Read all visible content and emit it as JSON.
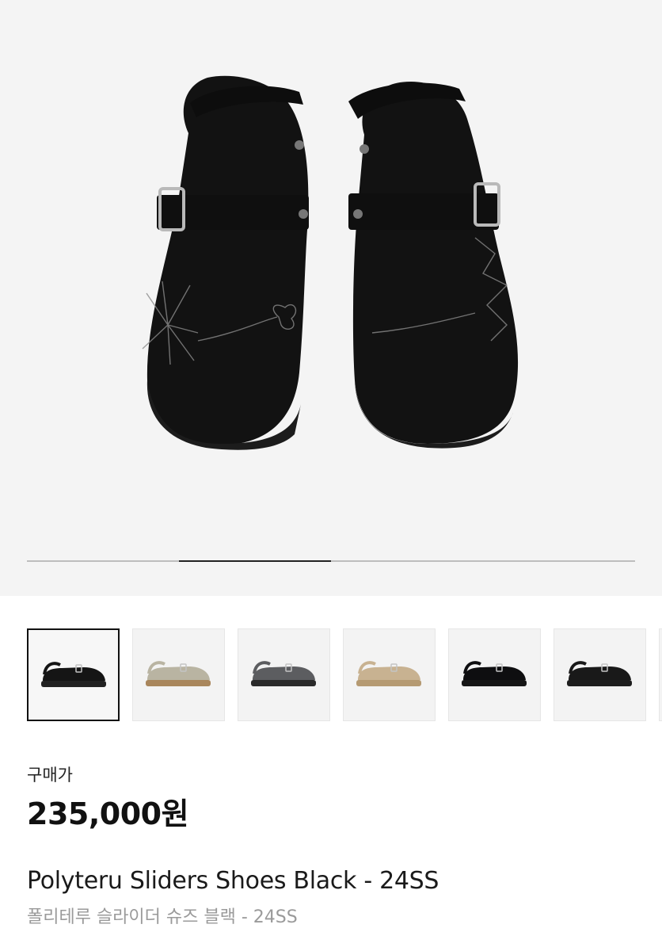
{
  "gallery": {
    "current_slide": 2,
    "total_slides": 4,
    "image_alt": "product-photo-black-suede-sliders"
  },
  "thumbnails": [
    {
      "color_name": "black-suede",
      "upper": "#151515",
      "sole": "#222222",
      "selected": true
    },
    {
      "color_name": "grey-beige",
      "upper": "#b9b4a2",
      "sole": "#a9865c",
      "selected": false
    },
    {
      "color_name": "charcoal-grey",
      "upper": "#5c5d60",
      "sole": "#2a2a2a",
      "selected": false
    },
    {
      "color_name": "sand-beige",
      "upper": "#c8b291",
      "sole": "#b59a72",
      "selected": false
    },
    {
      "color_name": "black-nylon",
      "upper": "#0e0e10",
      "sole": "#161616",
      "selected": false
    },
    {
      "color_name": "black-leather",
      "upper": "#191919",
      "sole": "#1e1e1e",
      "selected": false
    }
  ],
  "price": {
    "label": "구매가",
    "amount": "235,000원"
  },
  "product": {
    "name_en": "Polyteru Sliders Shoes Black - 24SS",
    "name_ko": "폴리테루 슬라이더 슈즈 블랙 - 24SS"
  },
  "colors": {
    "hero_bg": "#f4f4f4",
    "progress_track": "#bdbdbd",
    "progress_fill": "#222222"
  }
}
